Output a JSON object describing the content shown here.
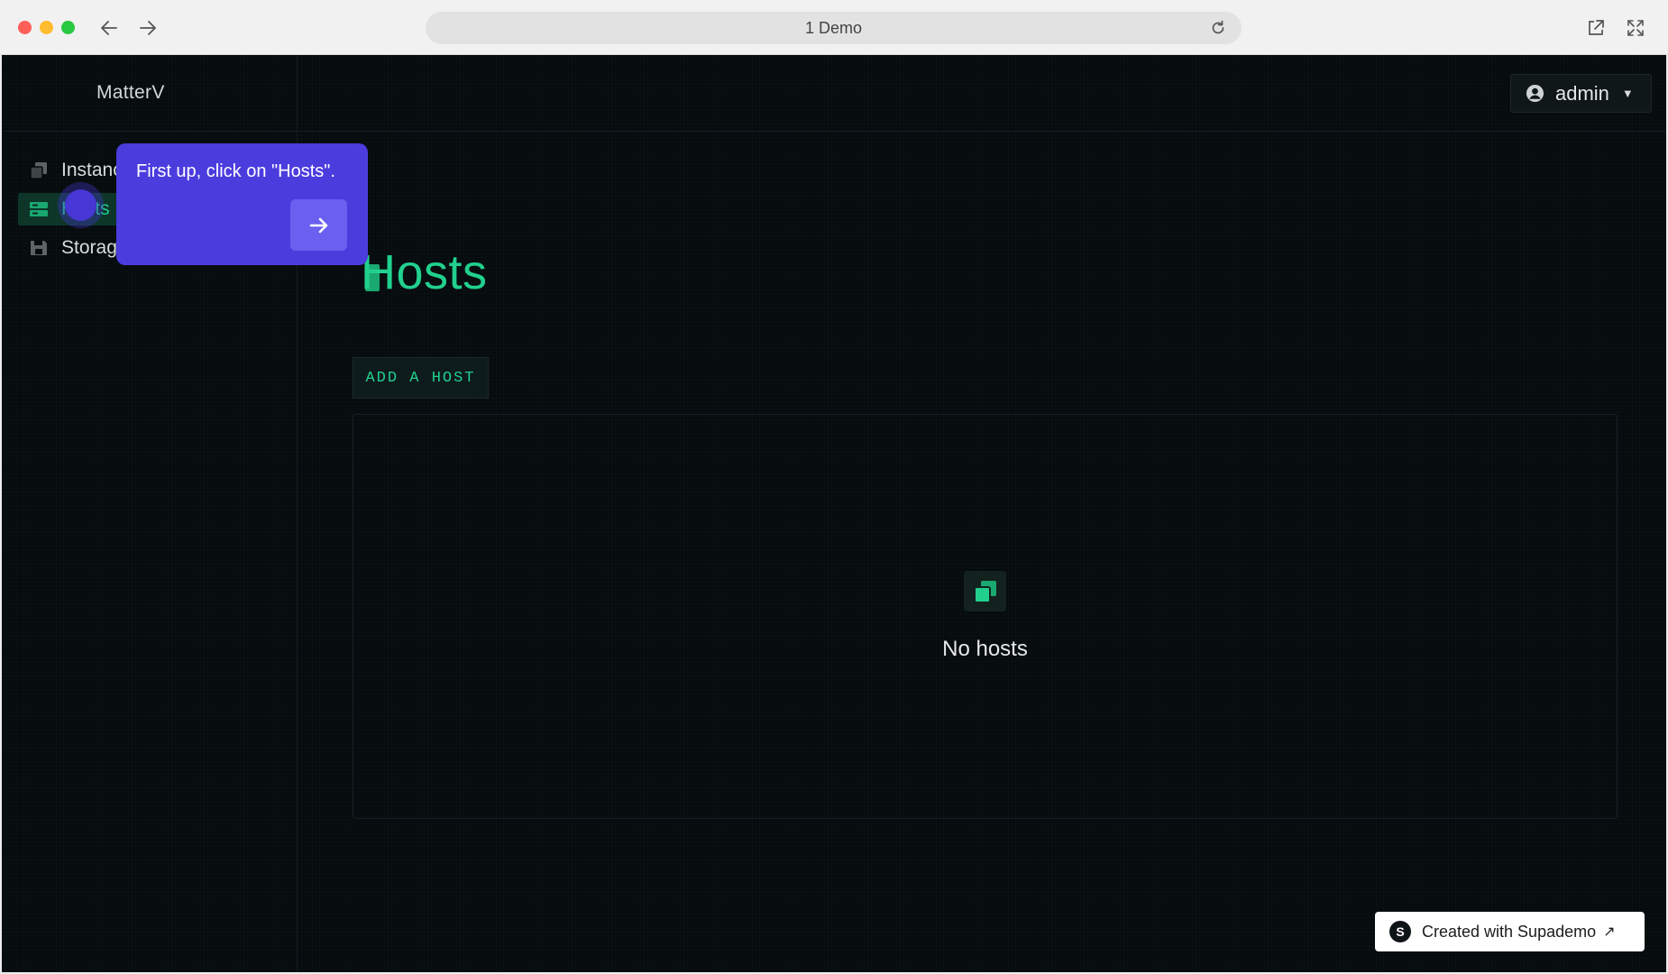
{
  "browser": {
    "url_title": "1 Demo"
  },
  "app": {
    "brand": "MatterV",
    "user": {
      "name": "admin",
      "caret": "▼"
    },
    "sidebar": {
      "items": [
        {
          "label": "Instances",
          "icon": "instances-icon"
        },
        {
          "label": "Hosts",
          "icon": "hosts-icon",
          "active": true
        },
        {
          "label": "Storage",
          "icon": "storage-icon"
        }
      ]
    },
    "page": {
      "title": "Hosts",
      "add_button": "ADD A HOST",
      "empty_state": "No hosts"
    }
  },
  "tooltip": {
    "text": "First up, click on \"Hosts\".",
    "next_icon": "arrow-right-icon"
  },
  "badge": {
    "logo_letter": "S",
    "text": "Created with Supademo",
    "arrow": "↗"
  },
  "colors": {
    "accent": "#21d08e",
    "background": "#060c0e",
    "tooltip": "#4b3cde"
  }
}
